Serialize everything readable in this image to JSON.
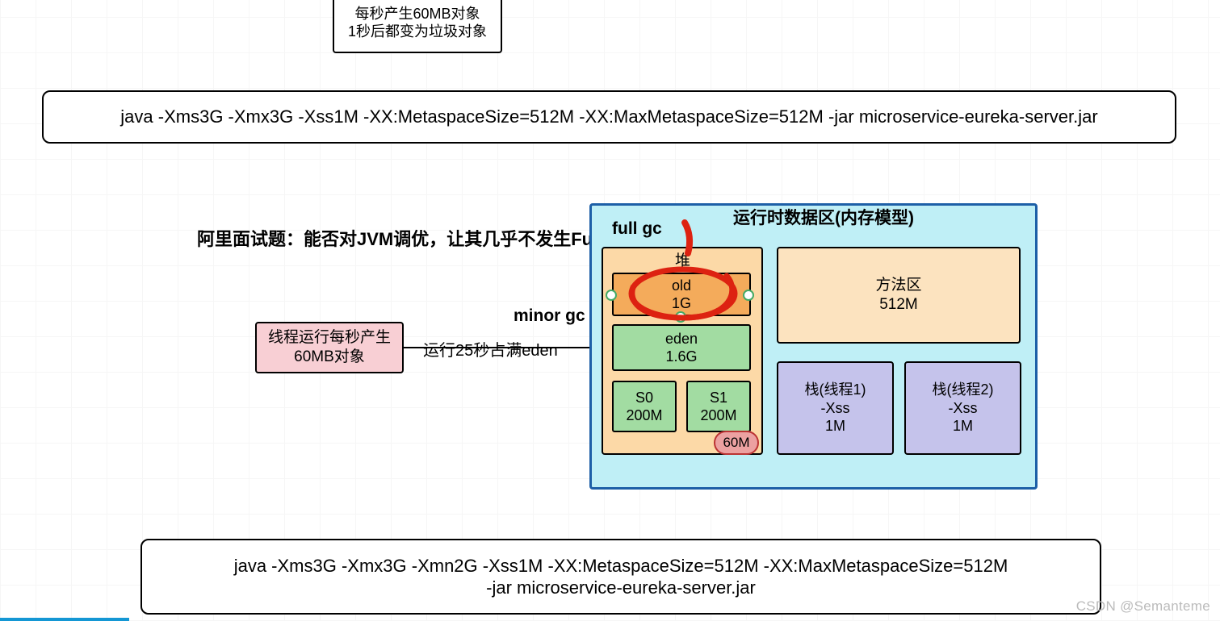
{
  "top_box": {
    "line1": "每秒产生60MB对象",
    "line2": "1秒后都变为垃圾对象"
  },
  "cmd1": "java -Xms3G -Xmx3G -Xss1M  -XX:MetaspaceSize=512M -XX:MaxMetaspaceSize=512M  -jar microservice-eureka-server.jar",
  "cmd2_line1": "java -Xms3G -Xmx3G -Xmn2G -Xss1M  -XX:MetaspaceSize=512M -XX:MaxMetaspaceSize=512M",
  "cmd2_line2": "-jar microservice-eureka-server.jar",
  "question": "阿里面试题：能否对JVM调优，让其几乎不发生Full GC",
  "thread": {
    "line1": "线程运行每秒产生",
    "line2": "60MB对象"
  },
  "arrow_label": "运行25秒占满eden",
  "minor_gc": "minor gc",
  "runtime_title": "运行时数据区(内存模型)",
  "full_gc": "full gc",
  "heap_title": "堆",
  "old": {
    "name": "old",
    "size": "1G"
  },
  "eden": {
    "name": "eden",
    "size": "1.6G"
  },
  "s0": {
    "name": "S0",
    "size": "200M"
  },
  "s1": {
    "name": "S1",
    "size": "200M"
  },
  "sixty": "60M",
  "method": {
    "name": "方法区",
    "size": "512M"
  },
  "stack1": {
    "name": "栈(线程1)",
    "opt": "-Xss",
    "size": "1M"
  },
  "stack2": {
    "name": "栈(线程2)",
    "opt": "-Xss",
    "size": "1M"
  },
  "watermark": "CSDN @Semanteme",
  "chart_data": {
    "type": "diagram",
    "title": "运行时数据区(内存模型)",
    "heap_total": "3G",
    "young": {
      "eden": "1.6G",
      "s0": "200M",
      "s1": "200M"
    },
    "old": "1G",
    "metaspace": "512M",
    "thread_stack": "1M",
    "object_alloc_rate": "60MB/s",
    "eden_fill_time_seconds": 25,
    "annotations": [
      "full gc",
      "minor gc"
    ],
    "jvm_flags_before": "java -Xms3G -Xmx3G -Xss1M -XX:MetaspaceSize=512M -XX:MaxMetaspaceSize=512M -jar microservice-eureka-server.jar",
    "jvm_flags_after": "java -Xms3G -Xmx3G -Xmn2G -Xss1M -XX:MetaspaceSize=512M -XX:MaxMetaspaceSize=512M -jar microservice-eureka-server.jar"
  }
}
